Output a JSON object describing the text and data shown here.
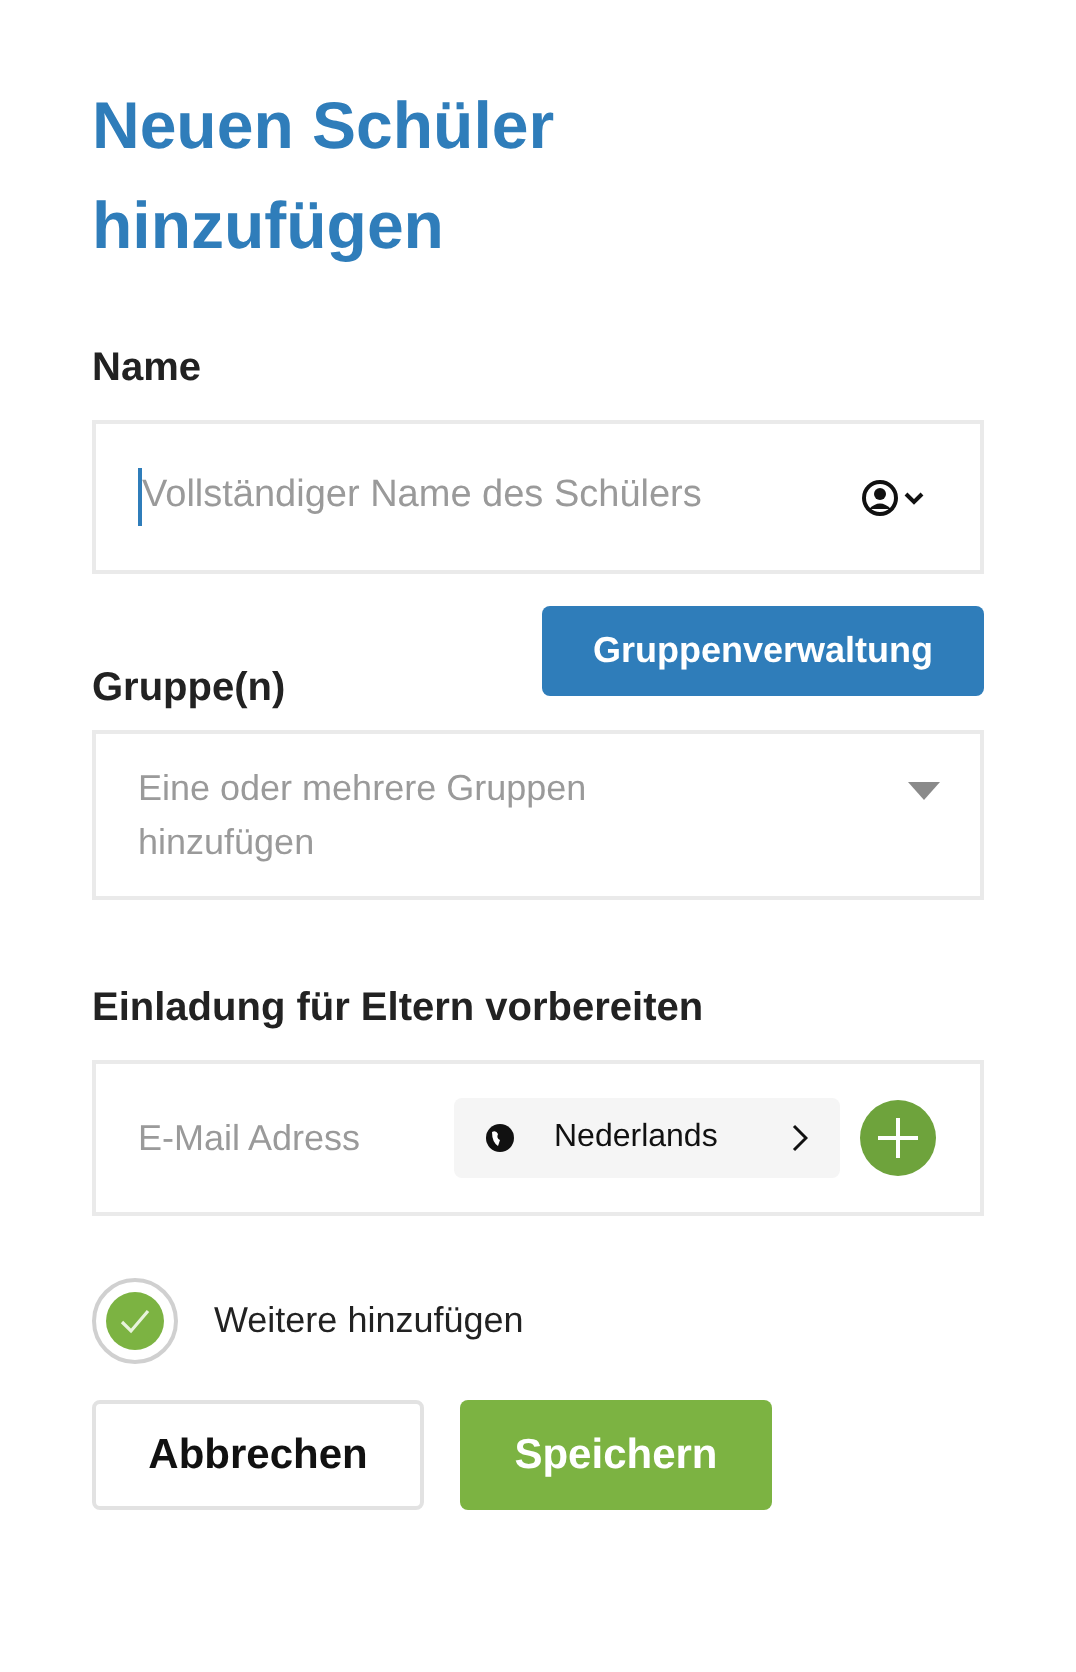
{
  "title": "Neuen Schüler hinzufügen",
  "name": {
    "label": "Name",
    "placeholder": "Vollständiger Name des Schülers"
  },
  "groups": {
    "label": "Gruppe(n)",
    "manage_button": "Gruppenverwaltung",
    "placeholder": "Eine oder mehrere Gruppen hinzufügen"
  },
  "invite": {
    "label": "Einladung für Eltern vorbereiten",
    "placeholder": "E-Mail Adress",
    "language": "Nederlands"
  },
  "add_more": {
    "label": "Weitere hinzufügen",
    "checked": true
  },
  "buttons": [
    {
      "label": "Abbrechen",
      "kind": "secondary"
    },
    {
      "label": "Speichern",
      "kind": "primary"
    }
  ]
}
